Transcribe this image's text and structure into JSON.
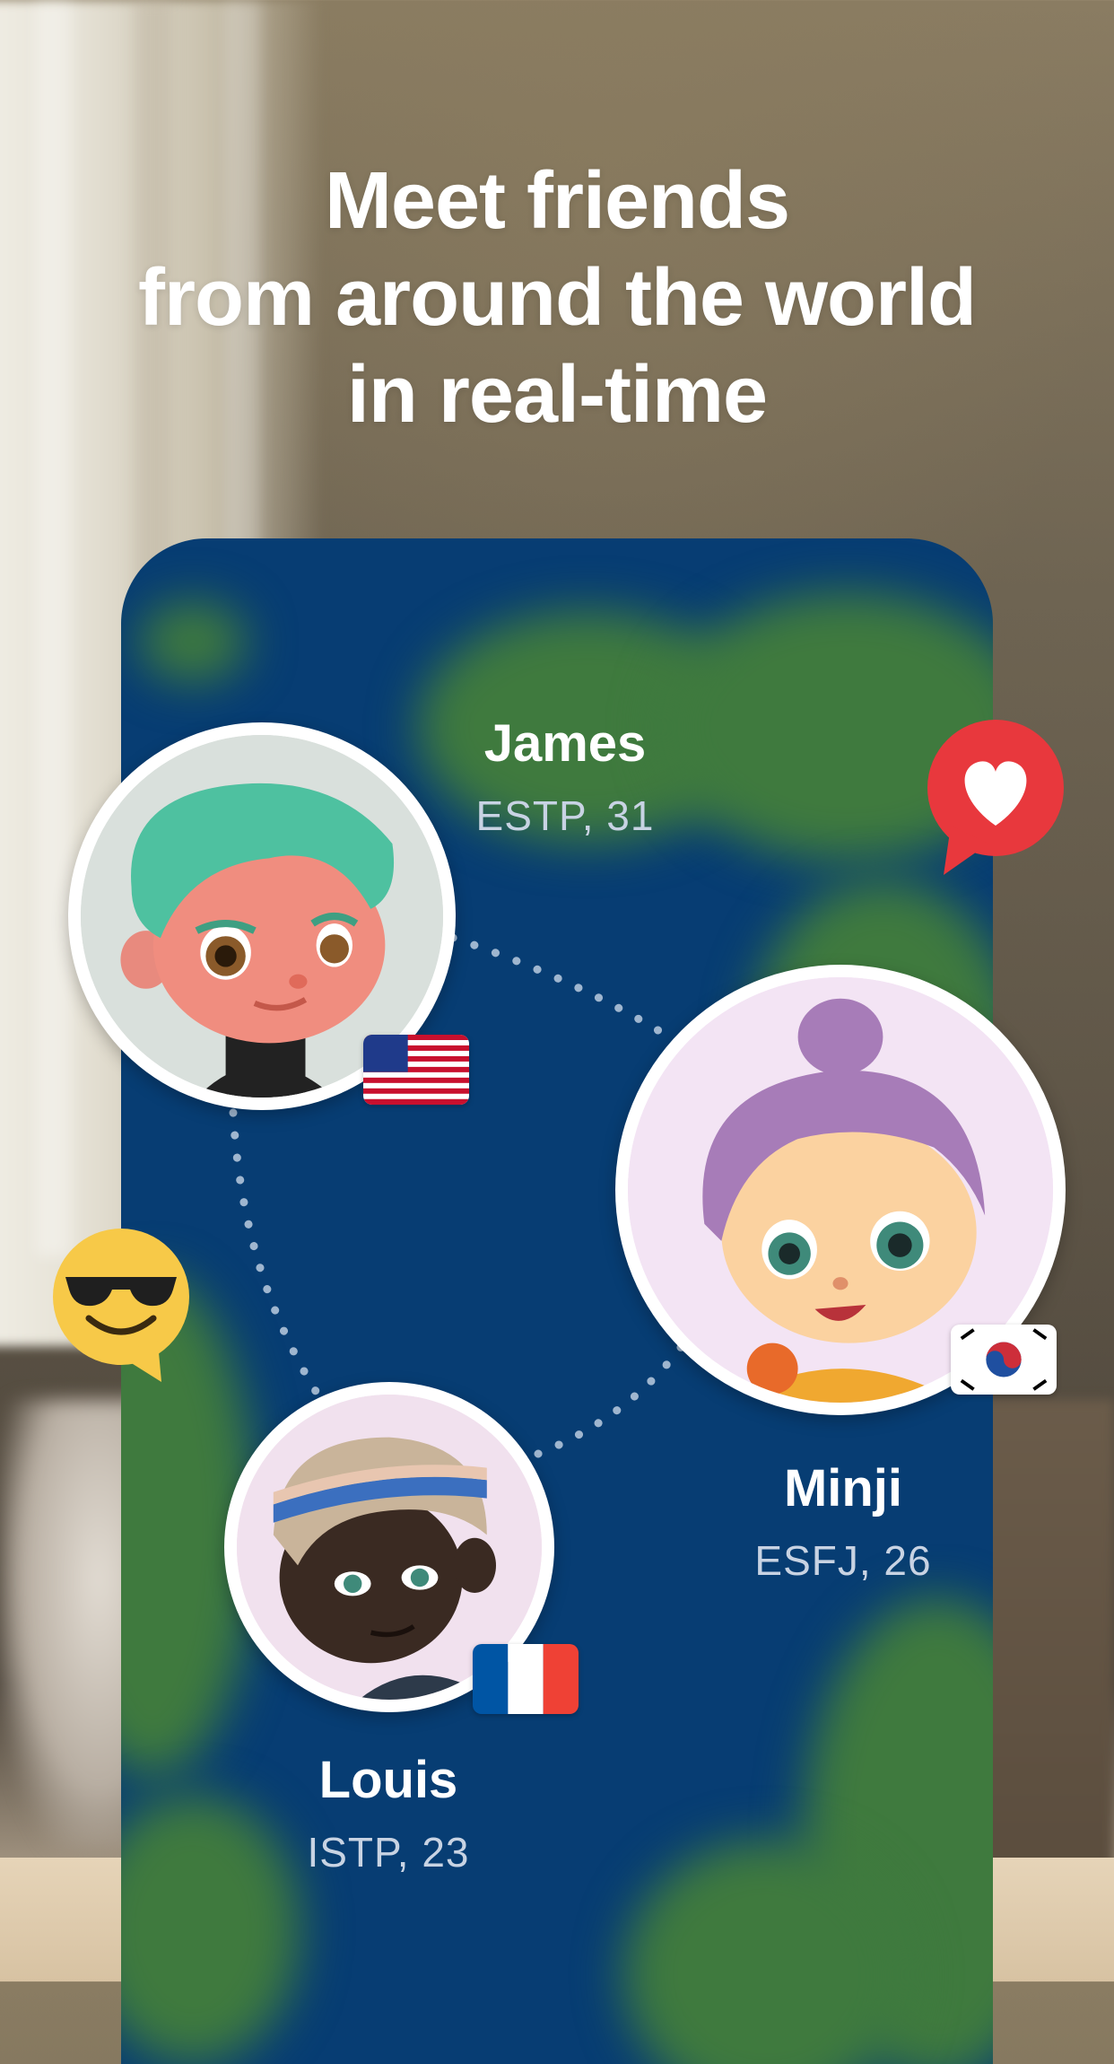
{
  "headline": {
    "line1": "Meet friends",
    "line2": "from around the world",
    "line3": "in real-time"
  },
  "users": [
    {
      "name": "James",
      "meta": "ESTP, 31",
      "flag": "flag-usa-icon"
    },
    {
      "name": "Minji",
      "meta": "ESFJ, 26",
      "flag": "flag-south-korea-icon"
    },
    {
      "name": "Louis",
      "meta": "ISTP, 23",
      "flag": "flag-france-icon"
    }
  ],
  "reactions": [
    {
      "icon": "heart-speech-bubble-icon",
      "color": "#e8383d"
    },
    {
      "icon": "sunglasses-emoji-bubble-icon",
      "color": "#f7c948"
    }
  ],
  "colors": {
    "map_ocean": "#073d73",
    "map_land": "#3f7a3e",
    "text_primary": "#ffffff",
    "text_secondary": "#c8d3e3"
  }
}
